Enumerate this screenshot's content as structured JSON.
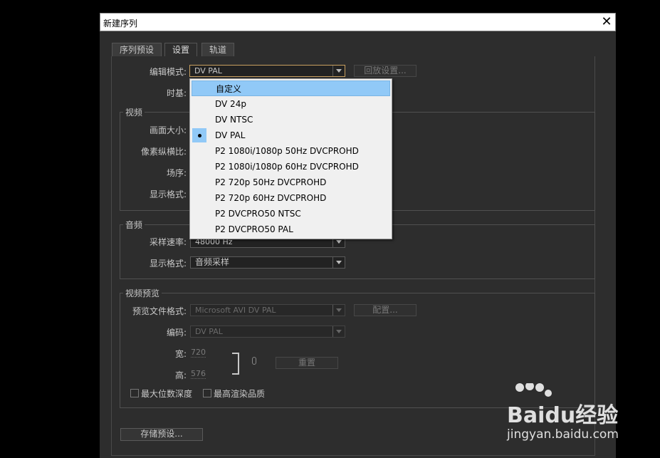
{
  "window": {
    "title": "新建序列"
  },
  "tabs": [
    "序列预设",
    "设置",
    "轨道"
  ],
  "edit_mode": {
    "label": "编辑模式:",
    "value": "DV PAL",
    "playback_button": "回放设置..."
  },
  "timebase": {
    "label": "时基:"
  },
  "video": {
    "title": "视频",
    "frame_size_label": "画面大小:",
    "pixel_aspect_label": "像素纵横比:",
    "fields_label": "场序:",
    "display_format_label": "显示格式:"
  },
  "audio": {
    "title": "音频",
    "sample_rate_label": "采样速率:",
    "sample_rate_value": "48000 Hz",
    "display_format_label": "显示格式:",
    "display_format_value": "音频采样"
  },
  "video_preview": {
    "title": "视频预览",
    "file_format_label": "预览文件格式:",
    "file_format_value": "Microsoft AVI DV PAL",
    "configure_button": "配置...",
    "codec_label": "编码:",
    "codec_value": "DV PAL",
    "width_label": "宽:",
    "width_value": "720",
    "height_label": "高:",
    "height_value": "576",
    "reset_button": "重置",
    "max_bit_depth": "最大位数深度",
    "max_render_quality": "最高渲染品质"
  },
  "save_preset_button": "存储预设...",
  "dropdown": {
    "items": [
      "自定义",
      "DV 24p",
      "DV NTSC",
      "DV PAL",
      "P2 1080i/1080p 50Hz DVCPROHD",
      "P2 1080i/1080p 60Hz DVCPROHD",
      "P2 720p 50Hz DVCPROHD",
      "P2 720p 60Hz DVCPROHD",
      "P2 DVCPRO50 NTSC",
      "P2 DVCPRO50 PAL"
    ],
    "highlighted": "自定义",
    "selected": "DV PAL"
  },
  "watermark": {
    "line1": "Baidu经验",
    "line2": "jingyan.baidu.com"
  }
}
